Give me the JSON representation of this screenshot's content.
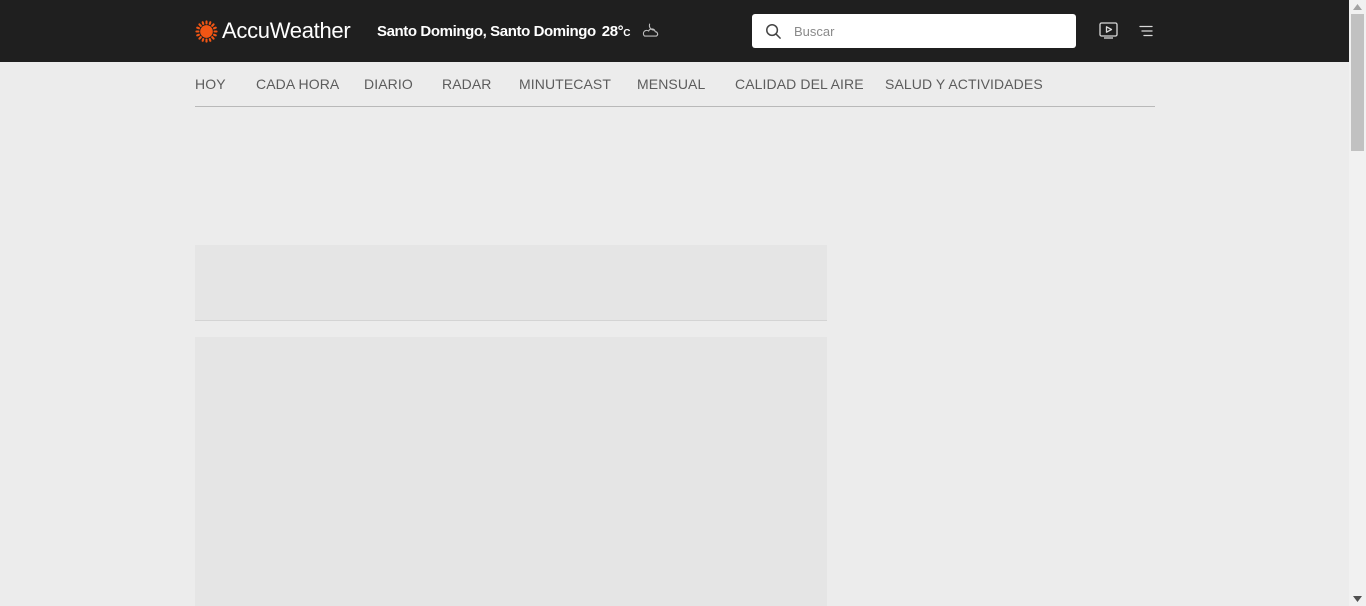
{
  "header": {
    "brand": "AccuWeather",
    "location": "Santo Domingo, Santo Domingo",
    "temperature": "28°",
    "temperature_unit": "C",
    "condition_icon": "cloudy-night-icon",
    "search": {
      "placeholder": "Buscar"
    },
    "icons": [
      "search-icon",
      "video-icon",
      "menu-icon"
    ],
    "brand_color": "#f05514",
    "bar_color": "#1f1f1f"
  },
  "nav": {
    "items": [
      {
        "label": "HOY"
      },
      {
        "label": "CADA HORA"
      },
      {
        "label": "DIARIO"
      },
      {
        "label": "RADAR"
      },
      {
        "label": "MINUTECAST"
      },
      {
        "label": "MENSUAL"
      },
      {
        "label": "CALIDAD DEL AIRE"
      },
      {
        "label": "SALUD Y ACTIVIDADES"
      }
    ]
  }
}
